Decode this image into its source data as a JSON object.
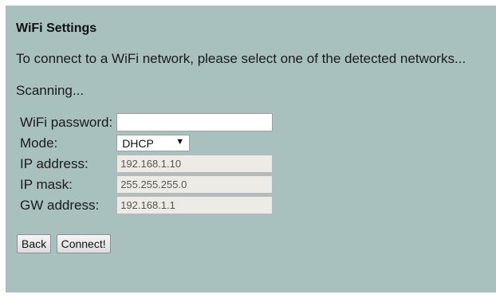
{
  "title": "WiFi Settings",
  "intro": "To connect to a WiFi network, please select one of the detected networks...",
  "status": "Scanning...",
  "form": {
    "password_label": "WiFi password:",
    "password_value": "",
    "mode_label": "Mode:",
    "mode_value": "DHCP",
    "ip_label": "IP address:",
    "ip_value": "192.168.1.10",
    "mask_label": "IP mask:",
    "mask_value": "255.255.255.0",
    "gw_label": "GW address:",
    "gw_value": "192.168.1.1"
  },
  "buttons": {
    "back": "Back",
    "connect": "Connect!"
  },
  "colors": {
    "panel_background": "#a8c1bf",
    "disabled_field": "#ecebe6"
  }
}
